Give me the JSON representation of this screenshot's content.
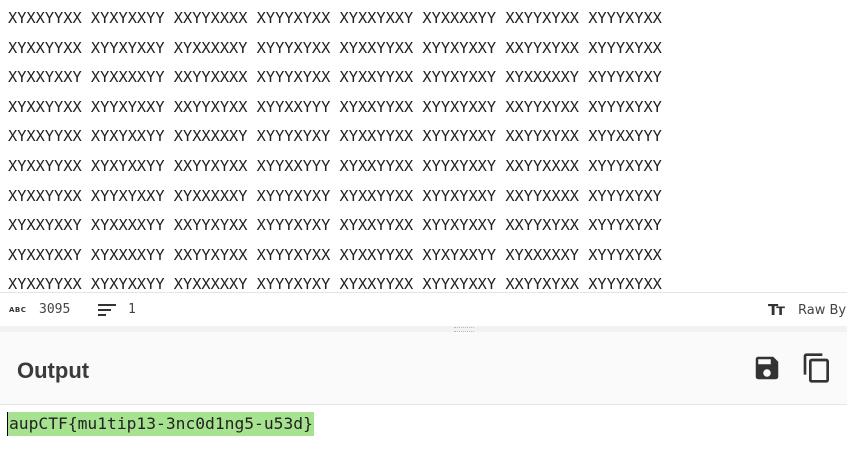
{
  "input": {
    "lines": [
      "XYXXYYXX XYXYXXYY XXYYXXXX XYYYXYXX XYXXYXXY XYXXXXYY XXYYXYXX XYYYXYXX",
      "XYXXYYXX XYYXYXXY XYXXXXXY XYYYXYXX XYXXYYXX XYYXYXXY XXYYXYXX XYYYXYXX",
      "XYXXYXXY XYXXXXYY XXYYXXXX XYYYXYXX XYXXYYXX XYYXYXXY XYXXXXXY XYYYXYXY",
      "XYXXYYXX XYYXYXXY XXYYXYXX XYYXXYYY XYXXYYXX XYYXYXXY XXYYXYXX XYYYXYXY",
      "XYXXYYXX XYXYXXYY XYXXXXXY XYYYXYXY XYXXYYXX XYYXYXXY XXYYXYXX XYYXXYYY",
      "XYXXYYXX XYXYXXYY XXYYXYXX XYYXXYYY XYXXYYXX XYYXYXXY XXYYXXXX XYYYXYXY",
      "XYXXYYXX XYYXYXXY XYXXXXXY XYYYXYXY XYXXYYXX XYYXYXXY XXYYXXXX XYYYXYXY",
      "XYXXYXXY XYXXXXYY XXYYXYXX XYYYXYXY XYXXYYXX XYYXYXXY XXYYXYXX XYYYXYXY",
      "XYXXYXXY XYXXXXYY XXYYXYXX XYYYXYXX XYXXYYXX XYXYXXYY XYXXXXXY XYYYXYXX",
      "XYXXYYXX XYXYXXYY XYXXXXXY XYYYXYXY XYXXYYXX XYYXYXXY XXYYXYXX XYYYXYXX"
    ]
  },
  "status": {
    "abc_label": "ABC",
    "char_count": "3095",
    "line_count": "1",
    "raw_label": "Raw By"
  },
  "output": {
    "title": "Output",
    "text": "aupCTF{mu1tip13-3nc0d1ng5-u53d}"
  },
  "colors": {
    "highlight": "#a6e28f",
    "header_bg": "#fafafa"
  },
  "icons": {
    "abc": "abc-icon",
    "lines": "lines-icon",
    "text_size": "text-size-icon",
    "save": "save-icon",
    "copy": "copy-icon"
  }
}
